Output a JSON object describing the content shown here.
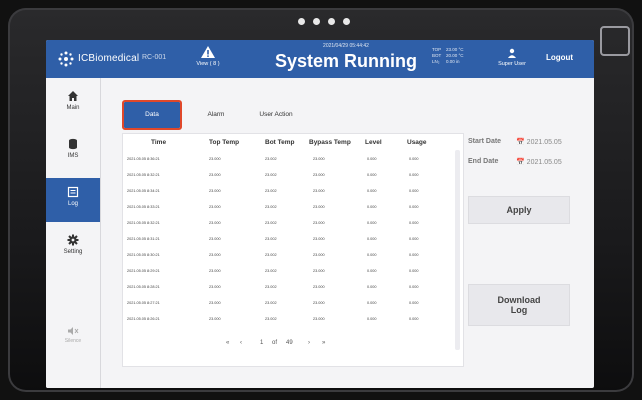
{
  "header": {
    "brand": "ICBiomedical",
    "device_code": "RC-001",
    "view_label": "View ( 8 )",
    "datetime": "2021/04/29 05:44:42",
    "title": "System Running",
    "readouts": [
      {
        "key": "TOP",
        "value": "23.00 °C"
      },
      {
        "key": "BOT",
        "value": "20.00 °C"
      },
      {
        "key": "LN₂",
        "value": "0.00 in"
      }
    ],
    "user_label": "Super User",
    "logout_label": "Logout"
  },
  "sidebar": {
    "items": [
      {
        "label": "Main",
        "icon": "home-icon"
      },
      {
        "label": "IMS",
        "icon": "database-icon"
      },
      {
        "label": "Log",
        "icon": "log-icon"
      },
      {
        "label": "Setting",
        "icon": "gear-icon"
      }
    ],
    "mute_label": "Silence"
  },
  "tabs": [
    "Data",
    "Alarm",
    "User Action"
  ],
  "table": {
    "columns": [
      "Time",
      "Top Temp",
      "Bot Temp",
      "Bypass Temp",
      "Level",
      "Usage"
    ],
    "rows": [
      [
        "2021.05.05 8:36:21",
        "23.000",
        "23.002",
        "23.000",
        "0.000",
        "0.000"
      ],
      [
        "2021.05.05 8:32:21",
        "23.000",
        "23.002",
        "23.000",
        "0.000",
        "0.000"
      ],
      [
        "2021.05.05 8:34:21",
        "23.000",
        "23.002",
        "23.000",
        "0.000",
        "0.000"
      ],
      [
        "2021.05.05 8:33:21",
        "23.000",
        "23.002",
        "23.000",
        "0.000",
        "0.000"
      ],
      [
        "2021.05.05 8:32:21",
        "23.000",
        "23.002",
        "23.000",
        "0.000",
        "0.000"
      ],
      [
        "2021.05.05 8:31:21",
        "23.000",
        "23.002",
        "23.000",
        "0.000",
        "0.000"
      ],
      [
        "2021.05.05 8:30:21",
        "23.000",
        "23.002",
        "23.000",
        "0.000",
        "0.000"
      ],
      [
        "2021.05.05 8:29:21",
        "23.000",
        "23.002",
        "23.000",
        "0.000",
        "0.000"
      ],
      [
        "2021.05.05 8:28:21",
        "23.000",
        "23.002",
        "23.000",
        "0.000",
        "0.000"
      ],
      [
        "2021.05.05 8:27:21",
        "23.000",
        "23.002",
        "23.000",
        "0.000",
        "0.000"
      ],
      [
        "2021.05.05 8:26:21",
        "23.000",
        "23.002",
        "23.000",
        "0.000",
        "0.000"
      ]
    ]
  },
  "pager": {
    "first": "«",
    "prev": "‹",
    "page": "1",
    "of": "of",
    "total": "49",
    "next": "›",
    "last": "»"
  },
  "filters": {
    "start_label": "Start Date",
    "start_value": "2021.05.05",
    "end_label": "End Date",
    "end_value": "2021.05.05",
    "apply_label": "Apply",
    "download_label": "Download Log"
  },
  "colors": {
    "accent": "#2f5fa8",
    "highlight": "#e0482a"
  }
}
